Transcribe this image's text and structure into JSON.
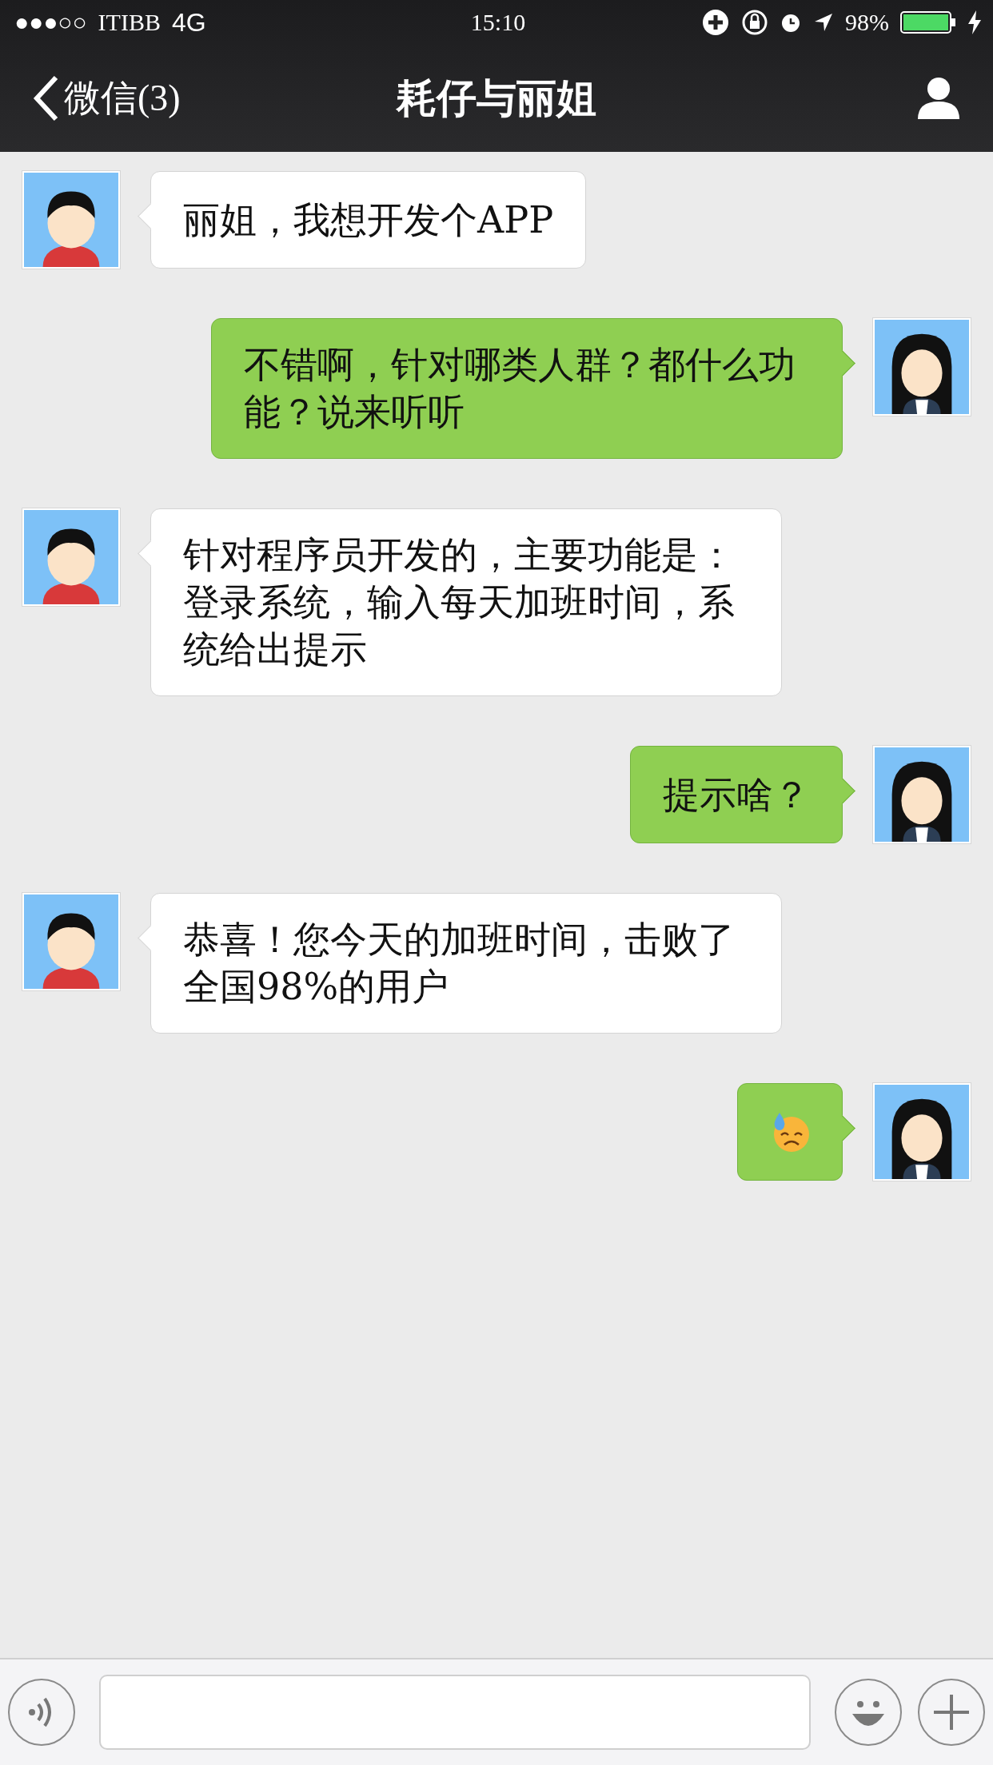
{
  "status_bar": {
    "signal": "●●●○○",
    "carrier": "ITIBB",
    "network": "4G",
    "time": "15:10",
    "battery": "98%"
  },
  "nav": {
    "back": "微信(3)",
    "title": "耗仔与丽姐"
  },
  "messages": [
    {
      "outgoing": false,
      "kind": "text",
      "text": "丽姐，我想开发个APP"
    },
    {
      "outgoing": true,
      "kind": "text",
      "text": "不错啊，针对哪类人群？都什么功能？说来听听"
    },
    {
      "outgoing": false,
      "kind": "text",
      "text": "针对程序员开发的，主要功能是：登录系统，输入每天加班时间，系统给出提示"
    },
    {
      "outgoing": true,
      "kind": "text",
      "text": "提示啥？"
    },
    {
      "outgoing": false,
      "kind": "text",
      "text": "恭喜！您今天的加班时间，击败了全国98%的用户"
    },
    {
      "outgoing": true,
      "kind": "emoji"
    }
  ]
}
